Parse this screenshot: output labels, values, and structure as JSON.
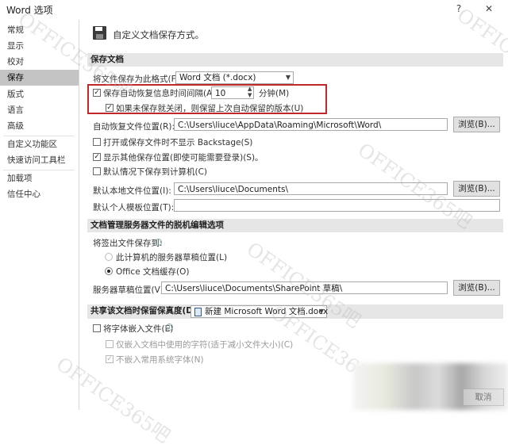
{
  "window": {
    "title": "Word 选项",
    "help": "?",
    "close": "✕"
  },
  "sidebar": {
    "items": [
      {
        "label": "常规"
      },
      {
        "label": "显示"
      },
      {
        "label": "校对"
      },
      {
        "label": "保存"
      },
      {
        "label": "版式"
      },
      {
        "label": "语言"
      },
      {
        "label": "高级"
      },
      {
        "label": "自定义功能区"
      },
      {
        "label": "快速访问工具栏"
      },
      {
        "label": "加载项"
      },
      {
        "label": "信任中心"
      }
    ],
    "active": "保存"
  },
  "header": {
    "text": "自定义文档保存方式。"
  },
  "save_docs": {
    "title": "保存文档",
    "format_label": "将文件保存为此格式(F):",
    "format_value": "Word 文档 (*.docx)",
    "autorecover_label": "保存自动恢复信息时间间隔(A)",
    "autorecover_minutes": "10",
    "minutes_unit": "分钟(M)",
    "keep_last_label": "如果未保存就关闭，则保留上次自动保留的版本(U)",
    "autorecover_loc_label": "自动恢复文件位置(R):",
    "autorecover_loc_value": "C:\\Users\\liuce\\AppData\\Roaming\\Microsoft\\Word\\",
    "browse": "浏览(B)...",
    "no_backstage_label": "打开或保存文件时不显示 Backstage(S)",
    "show_more_label": "显示其他保存位置(即使可能需要登录)(S)。",
    "save_to_pc_label": "默认情况下保存到计算机(C)",
    "local_loc_label": "默认本地文件位置(I):",
    "local_loc_value": "C:\\Users\\liuce\\Documents\\",
    "template_loc_label": "默认个人模板位置(T):",
    "template_loc_value": ""
  },
  "offline": {
    "title": "文档管理服务器文件的脱机编辑选项",
    "checkout_label": "将签出文件保存到:",
    "server_drafts": "此计算机的服务器草稿位置(L)",
    "office_cache": "Office 文档缓存(O)",
    "server_drafts_loc_label": "服务器草稿位置(V):",
    "server_drafts_loc_value": "C:\\Users\\liuce\\Documents\\SharePoint 草稿\\",
    "browse": "浏览(B)..."
  },
  "fidelity": {
    "title": "共享该文档时保留保真度(D):",
    "doc_value": "新建 Microsoft Word 文档.docx",
    "embed_fonts": "将字体嵌入文件(E)",
    "embed_only_used": "仅嵌入文档中使用的字符(适于减小文件大小)(C)",
    "no_common_fonts": "不嵌入常用系统字体(N)"
  },
  "footer": {
    "cancel": "取消"
  },
  "watermark": {
    "text": "OFFICE365吧"
  }
}
